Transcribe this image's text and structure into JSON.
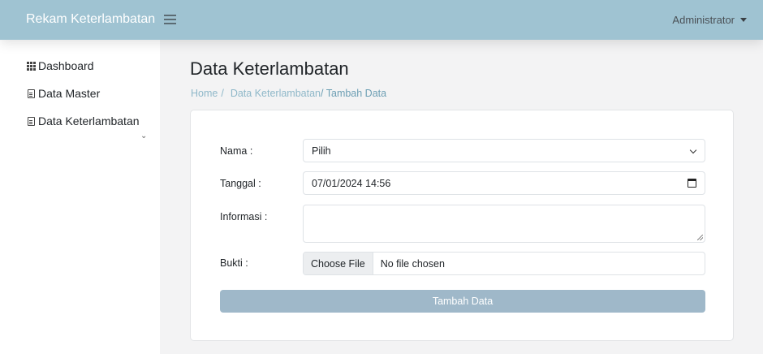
{
  "header": {
    "brand": "Rekam Keterlambatan",
    "user": "Administrator"
  },
  "sidebar": {
    "items": [
      {
        "label": "Dashboard",
        "icon": "grid-icon"
      },
      {
        "label": "Data Master",
        "icon": "file-icon",
        "has_submenu": true
      },
      {
        "label": "Data Keterlambatan",
        "icon": "document-icon"
      }
    ]
  },
  "page": {
    "title": "Data Keterlambatan",
    "breadcrumb": {
      "home": "Home",
      "separator": "/",
      "parent": "Data Keterlambatan",
      "current": "/ Tambah Data"
    }
  },
  "form": {
    "nama": {
      "label": "Nama :",
      "value": "Pilih"
    },
    "tanggal": {
      "label": "Tanggal :",
      "value": "07/01/2024 14:56"
    },
    "informasi": {
      "label": "Informasi :",
      "value": ""
    },
    "bukti": {
      "label": "Bukti :",
      "button": "Choose File",
      "status": "No file chosen"
    },
    "submit": "Tambah Data"
  },
  "colors": {
    "header_bg": "#9fc3d2",
    "button_bg": "#9fb8c9",
    "link": "#8fb8c9"
  }
}
